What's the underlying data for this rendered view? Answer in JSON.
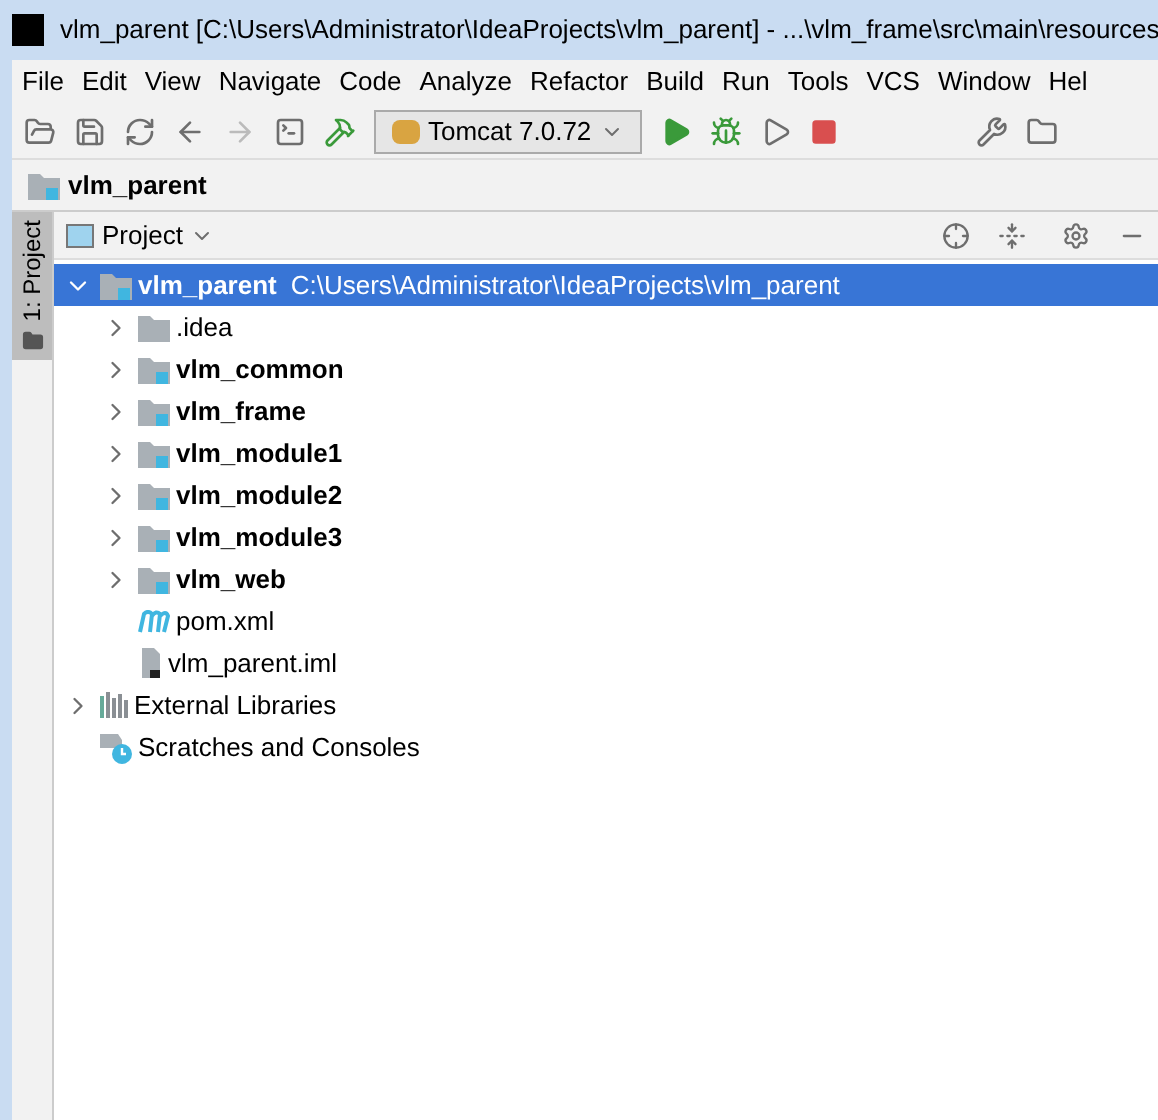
{
  "window": {
    "title": "vlm_parent [C:\\Users\\Administrator\\IdeaProjects\\vlm_parent] - ...\\vlm_frame\\src\\main\\resources"
  },
  "menu": [
    "File",
    "Edit",
    "View",
    "Navigate",
    "Code",
    "Analyze",
    "Refactor",
    "Build",
    "Run",
    "Tools",
    "VCS",
    "Window",
    "Hel"
  ],
  "toolbar": {
    "run_config": "Tomcat 7.0.72"
  },
  "navigation_bar": {
    "crumb": "vlm_parent"
  },
  "side_tab": {
    "label": "1: Project",
    "selected": true
  },
  "panel": {
    "title": "Project"
  },
  "tree": [
    {
      "kind": "module",
      "label": "vlm_parent",
      "path": "C:\\Users\\Administrator\\IdeaProjects\\vlm_parent",
      "expanded": true,
      "selected": true,
      "children": [
        {
          "kind": "folder",
          "label": ".idea",
          "expanded": false,
          "selected": false
        },
        {
          "kind": "module",
          "label": "vlm_common",
          "expanded": false,
          "selected": false
        },
        {
          "kind": "module",
          "label": "vlm_frame",
          "expanded": false,
          "selected": false
        },
        {
          "kind": "module",
          "label": "vlm_module1",
          "expanded": false,
          "selected": false
        },
        {
          "kind": "module",
          "label": "vlm_module2",
          "expanded": false,
          "selected": false
        },
        {
          "kind": "module",
          "label": "vlm_module3",
          "expanded": false,
          "selected": false
        },
        {
          "kind": "module",
          "label": "vlm_web",
          "expanded": false,
          "selected": false
        },
        {
          "kind": "maven",
          "label": "pom.xml",
          "selected": false
        },
        {
          "kind": "iml",
          "label": "vlm_parent.iml",
          "selected": false
        }
      ]
    },
    {
      "kind": "libraries",
      "label": "External Libraries",
      "expanded": false,
      "selected": false
    },
    {
      "kind": "scratches",
      "label": "Scratches and Consoles",
      "selected": false
    }
  ]
}
